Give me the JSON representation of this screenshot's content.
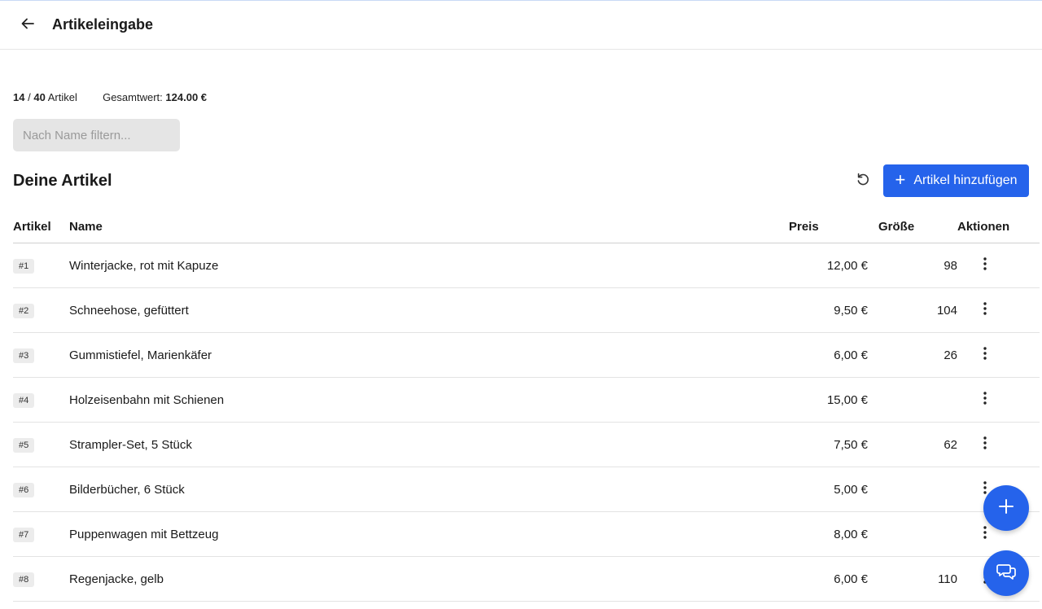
{
  "header": {
    "title": "Artikeleingabe",
    "back_icon": "arrow-left-icon"
  },
  "stats": {
    "count": "14",
    "separator": "/",
    "max": "40",
    "unit": "Artikel",
    "total_label": "Gesamtwert:",
    "total_value": "124.00 €"
  },
  "filter": {
    "placeholder": "Nach Name filtern...",
    "value": ""
  },
  "section": {
    "title": "Deine Artikel"
  },
  "toolbar": {
    "reset_icon": "refresh-icon",
    "add_label": "Artikel hinzufügen"
  },
  "table": {
    "columns": [
      "Artikel",
      "Name",
      "Preis",
      "Größe",
      "Aktionen"
    ],
    "rows": [
      {
        "id": "#1",
        "name": "Winterjacke, rot mit Kapuze",
        "price": "12,00 €",
        "size": "98"
      },
      {
        "id": "#2",
        "name": "Schneehose, gefüttert",
        "price": "9,50 €",
        "size": "104"
      },
      {
        "id": "#3",
        "name": "Gummistiefel, Marienkäfer",
        "price": "6,00 €",
        "size": "26"
      },
      {
        "id": "#4",
        "name": "Holzeisenbahn mit Schienen",
        "price": "15,00 €",
        "size": ""
      },
      {
        "id": "#5",
        "name": "Strampler-Set, 5 Stück",
        "price": "7,50 €",
        "size": "62"
      },
      {
        "id": "#6",
        "name": "Bilderbücher, 6 Stück",
        "price": "5,00 €",
        "size": ""
      },
      {
        "id": "#7",
        "name": "Puppenwagen mit Bettzeug",
        "price": "8,00 €",
        "size": ""
      },
      {
        "id": "#8",
        "name": "Regenjacke, gelb",
        "price": "6,00 €",
        "size": "110"
      }
    ]
  },
  "colors": {
    "accent": "#2563eb",
    "filter_bg": "#e5e5e5",
    "badge_bg": "#ececec"
  }
}
